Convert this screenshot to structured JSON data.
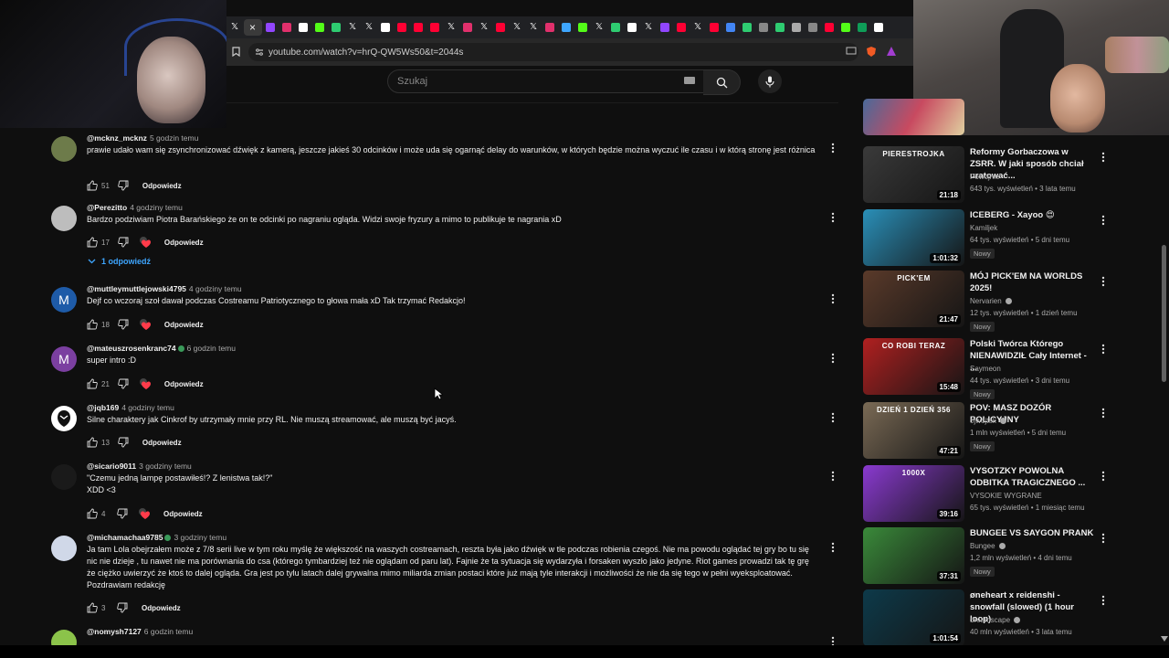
{
  "browser": {
    "url": "youtube.com/watch?v=hrQ-QW5Ws50&t=2044s",
    "tabs": [
      {
        "icon": "x-icon",
        "color": "#ffffff"
      },
      {
        "icon": "active-tab",
        "color": "#ffffff"
      },
      {
        "icon": "twitch-icon",
        "color": "#9146ff"
      },
      {
        "icon": "instagram-icon",
        "color": "#e1306c"
      },
      {
        "icon": "tiktok-icon",
        "color": "#ffffff"
      },
      {
        "icon": "kick-icon",
        "color": "#53fc18"
      },
      {
        "icon": "tab-icon",
        "color": "#2ecc71"
      },
      {
        "icon": "x-icon",
        "color": "#ffffff"
      },
      {
        "icon": "x-icon",
        "color": "#ffffff"
      },
      {
        "icon": "tiktok-icon",
        "color": "#ffffff"
      },
      {
        "icon": "youtube-icon",
        "color": "#ff0033"
      },
      {
        "icon": "youtube-icon",
        "color": "#ff0033"
      },
      {
        "icon": "youtube-icon",
        "color": "#ff0033"
      },
      {
        "icon": "x-icon",
        "color": "#ffffff"
      },
      {
        "icon": "instagram-icon",
        "color": "#e1306c"
      },
      {
        "icon": "x-icon",
        "color": "#ffffff"
      },
      {
        "icon": "youtube-icon",
        "color": "#ff0033"
      },
      {
        "icon": "x-icon",
        "color": "#ffffff"
      },
      {
        "icon": "x-icon",
        "color": "#ffffff"
      },
      {
        "icon": "instagram-icon",
        "color": "#e1306c"
      },
      {
        "icon": "messenger-icon",
        "color": "#3ea6ff"
      },
      {
        "icon": "kick-icon",
        "color": "#53fc18"
      },
      {
        "icon": "x-icon",
        "color": "#ffffff"
      },
      {
        "icon": "loading-icon",
        "color": "#2ecc71"
      },
      {
        "icon": "tiktok-icon",
        "color": "#ffffff"
      },
      {
        "icon": "x-icon",
        "color": "#ffffff"
      },
      {
        "icon": "twitch-icon",
        "color": "#9146ff"
      },
      {
        "icon": "youtube-icon",
        "color": "#ff0033"
      },
      {
        "icon": "x-icon",
        "color": "#ffffff"
      },
      {
        "icon": "youtube-icon",
        "color": "#ff0033"
      },
      {
        "icon": "google-icon",
        "color": "#4285f4"
      },
      {
        "icon": "tab-icon",
        "color": "#2ecc71"
      },
      {
        "icon": "tab-icon",
        "color": "#888888"
      },
      {
        "icon": "tab-icon",
        "color": "#2ecc71"
      },
      {
        "icon": "globe-icon",
        "color": "#aaaaaa"
      },
      {
        "icon": "tab-icon",
        "color": "#888888"
      },
      {
        "icon": "youtube-icon",
        "color": "#ff0033"
      },
      {
        "icon": "kick-icon",
        "color": "#53fc18"
      },
      {
        "icon": "sheets-icon",
        "color": "#0f9d58"
      },
      {
        "icon": "tab-icon",
        "color": "#ffffff"
      }
    ]
  },
  "search": {
    "placeholder": "Szukaj"
  },
  "reply_label": "Odpowiedz",
  "show_replies": "1 odpowiedź",
  "comments": [
    {
      "handle": "@mcknz_mcknz",
      "time": "5 godzin temu",
      "text": "prawie udało wam się zsynchronizować dźwięk z kamerą, jeszcze jakieś 30 odcinków i może uda się ogarnąć delay do warunków, w których będzie można wyczuć ile czasu i w którą stronę jest różnica",
      "likes": "51",
      "hearted": false,
      "avatar_letter": "",
      "avatar_color": "#6d7b4a",
      "verified": false
    },
    {
      "handle": "@Perezitto",
      "time": "4 godziny temu",
      "text": "Bardzo podziwiam Piotra Barańskiego że on te odcinki po nagraniu ogląda. Widzi swoje fryzury a mimo to publikuje te nagrania xD",
      "likes": "17",
      "hearted": true,
      "avatar_letter": "",
      "avatar_color": "#bdbdbd",
      "verified": false
    },
    {
      "handle": "@muttleymuttlejowski4795",
      "time": "4 godziny temu",
      "text": "Dejf co wczoraj szoł dawał podczas Costreamu Patriotycznego to głowa mała xD Tak trzymać Redakcjo!",
      "likes": "18",
      "hearted": true,
      "avatar_letter": "M",
      "avatar_color": "#1e5ba8",
      "verified": false
    },
    {
      "handle": "@mateuszrosenkranc74",
      "time": "6 godzin temu",
      "text": "super intro :D",
      "likes": "21",
      "hearted": true,
      "avatar_letter": "M",
      "avatar_color": "#7b3fa0",
      "verified": true
    },
    {
      "handle": "@jqb169",
      "time": "4 godziny temu",
      "text": "Silne charaktery jak Cinkrof by utrzymały mnie przy RL. Nie muszą streamować, ale muszą być jacyś.",
      "likes": "13",
      "hearted": false,
      "avatar_letter": "",
      "avatar_color": "#ffffff",
      "verified": false
    },
    {
      "handle": "@sicario9011",
      "time": "3 godziny temu",
      "text": "\"Czemu jedną lampę postawiłeś!? Z lenistwa tak!?\"\nXDD <3",
      "likes": "4",
      "hearted": true,
      "avatar_letter": "",
      "avatar_color": "#1a1a1a",
      "verified": false
    },
    {
      "handle": "@michamachaa9785",
      "time": "3 godziny temu",
      "text": "Ja tam Lola obejrzałem może z 7/8 serii live w tym roku myślę że większość na waszych costreamach, reszta była jako dźwięk w tle podczas robienia czegoś. Nie ma powodu oglądać tej gry bo tu się nic nie dzieje , tu nawet nie ma porównania do csa (którego tymbardziej też nie oglądam od paru lat). Fajnie że ta sytuacja się wydarzyła i forsaken wyszło jako jedyne. Riot games prowadzi tak tę grę że ciężko uwierzyć że ktoś to dalej ogląda. Gra jest po tylu latach dalej grywalna mimo miliarda zmian postaci które już mają tyle interakcji i możliwości że nie da się tego w pełni wyeksploatować. Pozdrawiam redakcję",
      "likes": "3",
      "hearted": false,
      "avatar_letter": "",
      "avatar_color": "#d0d8e8",
      "verified": true
    },
    {
      "handle": "@nomysh7127",
      "time": "6 godzin temu",
      "text": "",
      "likes": "",
      "hearted": false,
      "avatar_letter": "",
      "avatar_color": "#8bc34a",
      "verified": false
    }
  ],
  "sidebar": [
    {
      "title": "Reformy Gorbaczowa w ZSRR. W jaki sposób chciał uratować...",
      "channel": "Powojnie",
      "verified": false,
      "meta": "643 tys. wyświetleń • 3 lata temu",
      "badge": "",
      "duration": "21:18",
      "thumb_label": "PIERESTROJKA",
      "thumb_color": "#3a3a3a"
    },
    {
      "title": "ICEBERG - Xayoo 😍",
      "channel": "Kamiljek",
      "verified": false,
      "meta": "64 tys. wyświetleń • 5 dni temu",
      "badge": "Nowy",
      "duration": "1:01:32",
      "thumb_label": "",
      "thumb_color": "#2a8fb8"
    },
    {
      "title": "MÓJ PICK'EM NA WORLDS 2025!",
      "channel": "Nervarien",
      "verified": true,
      "meta": "12 tys. wyświetleń • 1 dzień temu",
      "badge": "Nowy",
      "duration": "21:47",
      "thumb_label": "PICK'EM",
      "thumb_color": "#5a3a2a"
    },
    {
      "title": "Polski Twórca Którego NIENAWIDZIŁ Cały Internet - ...",
      "channel": "Saymeon",
      "verified": false,
      "meta": "44 tys. wyświetleń • 3 dni temu",
      "badge": "Nowy",
      "duration": "15:48",
      "thumb_label": "CO ROBI TERAZ",
      "thumb_color": "#b02020"
    },
    {
      "title": "POV: MASZ DOZÓR POLICYJNY",
      "channel": "ojwojtek",
      "verified": true,
      "meta": "1 mln wyświetleń • 5 dni temu",
      "badge": "Nowy",
      "duration": "47:21",
      "thumb_label": "DZIEŃ 1   DZIEŃ 356",
      "thumb_color": "#7a6a55"
    },
    {
      "title": "VYSOTZKY POWOLNA ODBITKA TRAGICZNEGO ...",
      "channel": "VYSOKIE WYGRANE",
      "verified": false,
      "meta": "65 tys. wyświetleń • 1 miesiąc temu",
      "badge": "",
      "duration": "39:16",
      "thumb_label": "1000X",
      "thumb_color": "#8a3ad0"
    },
    {
      "title": "BUNGEE VS SAYGON PRANK",
      "channel": "Bungee",
      "verified": true,
      "meta": "1,2 mln wyświetleń • 4 dni temu",
      "badge": "Nowy",
      "duration": "37:31",
      "thumb_label": "",
      "thumb_color": "#3a8a3a"
    },
    {
      "title": "øneheart x reidenshi - snowfall (slowed) (1 hour loop)",
      "channel": "dreamscape",
      "verified": true,
      "meta": "40 mln wyświetleń • 3 lata temu",
      "badge": "",
      "duration": "1:01:54",
      "thumb_label": "",
      "thumb_color": "#0d3a4a"
    }
  ]
}
